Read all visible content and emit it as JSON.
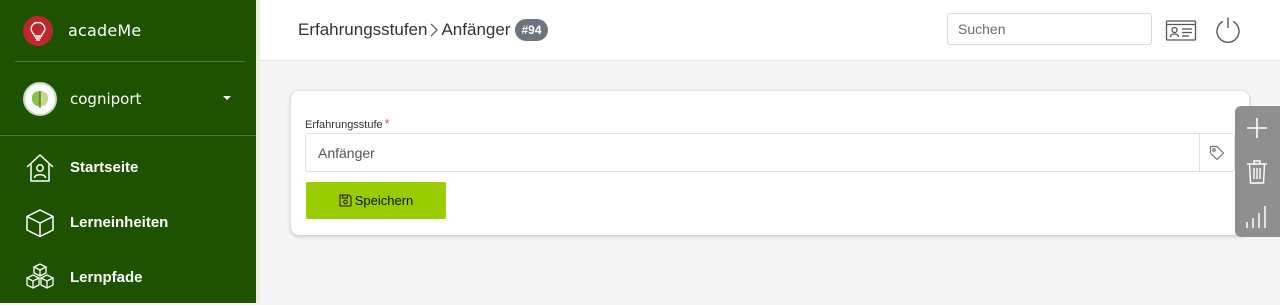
{
  "app": {
    "name": "acadeMe",
    "logo_icon": "lightbulb-icon",
    "logo_color": "#c0262d"
  },
  "org": {
    "name": "cogniport",
    "avatar_icon": "cogniport-logo-icon"
  },
  "nav": {
    "items": [
      {
        "label": "Startseite",
        "icon": "home-icon"
      },
      {
        "label": "Lerneinheiten",
        "icon": "cube-icon"
      },
      {
        "label": "Lernpfade",
        "icon": "cubes-stack-icon"
      }
    ]
  },
  "header": {
    "breadcrumb": [
      "Erfahrungsstufen",
      "Anfänger"
    ],
    "badge": "#94",
    "search": {
      "placeholder": "Suchen",
      "value": ""
    }
  },
  "form": {
    "label": "Erfahrungsstufe",
    "required_mark": "*",
    "value": "Anfänger",
    "save_label": "Speichern"
  },
  "colors": {
    "sidebar": "#1c5200",
    "accent": "#99cc00",
    "badge": "#6c757d",
    "fab_panel": "#8f8f8f"
  }
}
